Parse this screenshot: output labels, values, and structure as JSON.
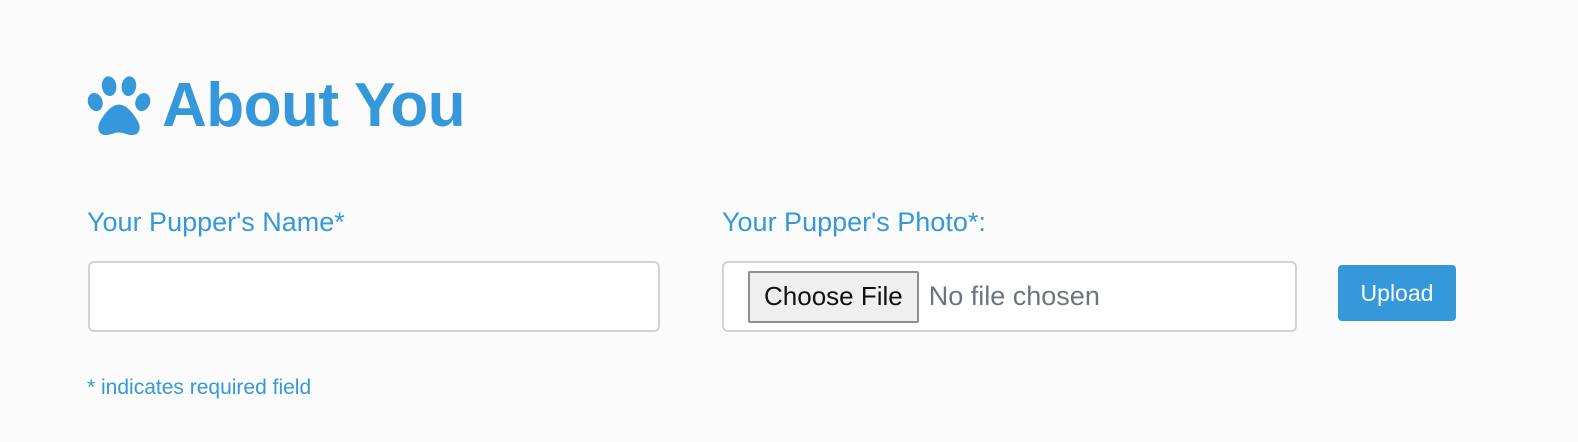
{
  "section": {
    "title": "About You",
    "icon": "paw-icon",
    "accent_color": "#3498db"
  },
  "form": {
    "name_field": {
      "label": "Your Pupper's Name*",
      "value": "",
      "placeholder": ""
    },
    "photo_field": {
      "label": "Your Pupper's Photo*:",
      "choose_button_label": "Choose File",
      "status_text": "No file chosen"
    },
    "upload_button_label": "Upload",
    "required_note": "* indicates required field"
  }
}
